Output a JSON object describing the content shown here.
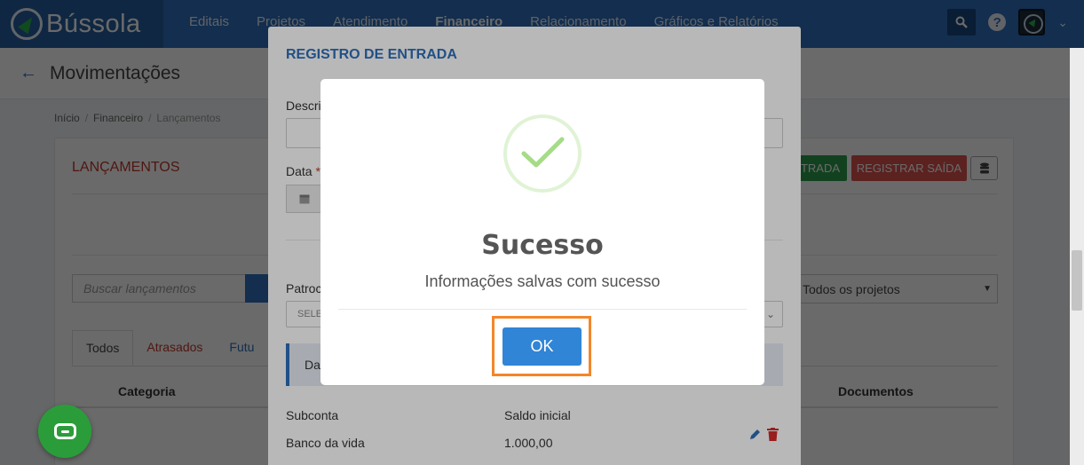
{
  "app": {
    "name": "Bússola",
    "nav": [
      "Editais",
      "Projetos",
      "Atendimento",
      "Financeiro",
      "Relacionamento",
      "Gráficos e Relatórios"
    ],
    "nav_active": "Financeiro",
    "help_icon": "?"
  },
  "page": {
    "title": "Movimentações",
    "breadcrumb": [
      "Início",
      "Financeiro",
      "Lançamentos"
    ]
  },
  "card": {
    "title": "LANÇAMENTOS",
    "btn_entrada": "TRADA",
    "btn_saida": "REGISTRAR SAÍDA",
    "search_placeholder": "Buscar lançamentos",
    "projects_select": "Todos os projetos",
    "tabs": [
      "Todos",
      "Atrasados",
      "Futu"
    ],
    "col_categoria": "Categoria",
    "col_documentos": "Documentos"
  },
  "entry_modal": {
    "title": "REGISTRO DE ENTRADA",
    "label_descricao": "Descri",
    "label_data": "Data",
    "required_mark": "*",
    "label_patrocinio": "Patroc",
    "select_placeholder": "SELE",
    "info_text": "Da",
    "subconta_header": "Subconta",
    "saldo_header": "Saldo inicial",
    "row_subconta": "Banco da vida",
    "row_saldo": "1.000,00"
  },
  "dialog": {
    "title": "Sucesso",
    "message": "Informações salvas com sucesso",
    "ok_label": "OK"
  },
  "colors": {
    "nav": "#2f6fba",
    "success_green": "#a5dc86",
    "ok_button": "#3085d6",
    "highlight": "#f3862a",
    "danger": "#d9534f",
    "chat": "#2a9d3a"
  }
}
